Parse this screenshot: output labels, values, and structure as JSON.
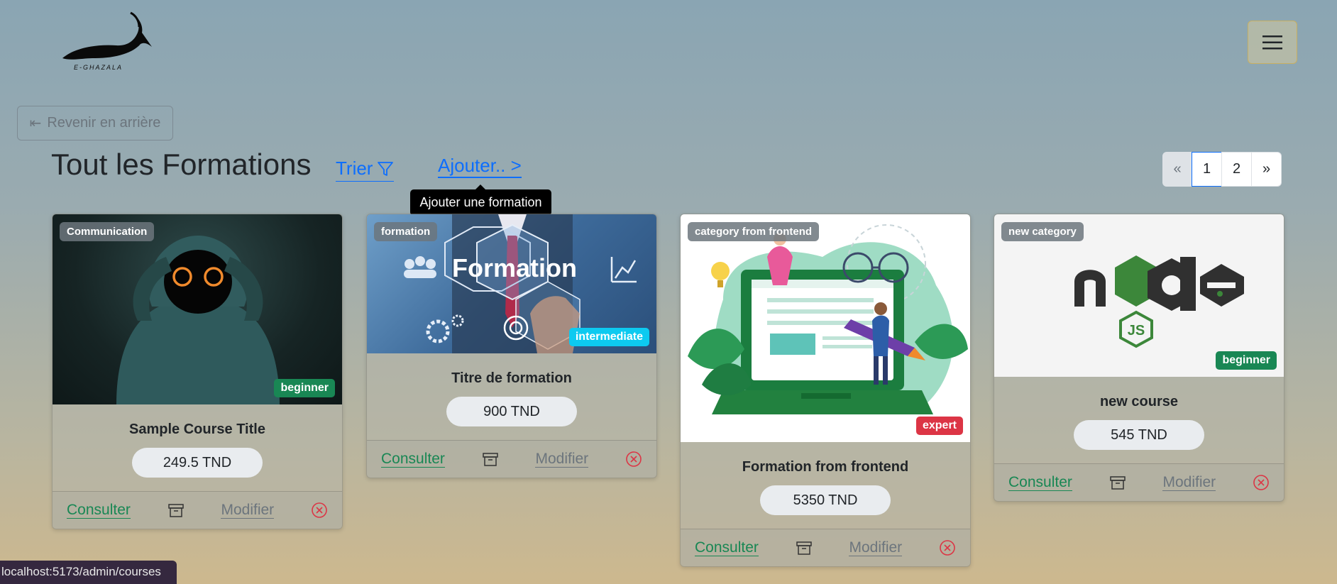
{
  "header": {
    "logo_text": "E-GHAZALA",
    "menu_icon": "hamburger-icon"
  },
  "back_button": {
    "icon": "back-arrow-icon",
    "label": "Revenir en arrière"
  },
  "page_title": "Tout les Formations",
  "sort": {
    "label": "Trier",
    "icon": "filter-icon"
  },
  "add": {
    "label": "Ajouter.. >",
    "tooltip": "Ajouter une formation"
  },
  "pagination": {
    "prev": "«",
    "pages": [
      "1",
      "2"
    ],
    "current": "1",
    "next": "»"
  },
  "courses": [
    {
      "category": "Communication",
      "level": "beginner",
      "title": "Sample Course Title",
      "price": "249.5 TND",
      "consult": "Consulter",
      "modify": "Modifier"
    },
    {
      "category": "formation",
      "level": "intermediate",
      "title": "Titre de formation",
      "price": "900 TND",
      "consult": "Consulter",
      "modify": "Modifier",
      "image_text": "Formation"
    },
    {
      "category": "category from frontend",
      "level": "expert",
      "title": "Formation from frontend",
      "price": "5350 TND",
      "consult": "Consulter",
      "modify": "Modifier"
    },
    {
      "category": "new category",
      "level": "beginner",
      "title": "new course",
      "price": "545 TND",
      "consult": "Consulter",
      "modify": "Modifier",
      "image_text": "node",
      "image_subtext": "JS"
    }
  ],
  "colors": {
    "beginner": "#198754",
    "intermediate": "#0dcaf0",
    "expert": "#dc3545",
    "link": "#0d6efd"
  },
  "status_bar": "localhost:5173/admin/courses"
}
